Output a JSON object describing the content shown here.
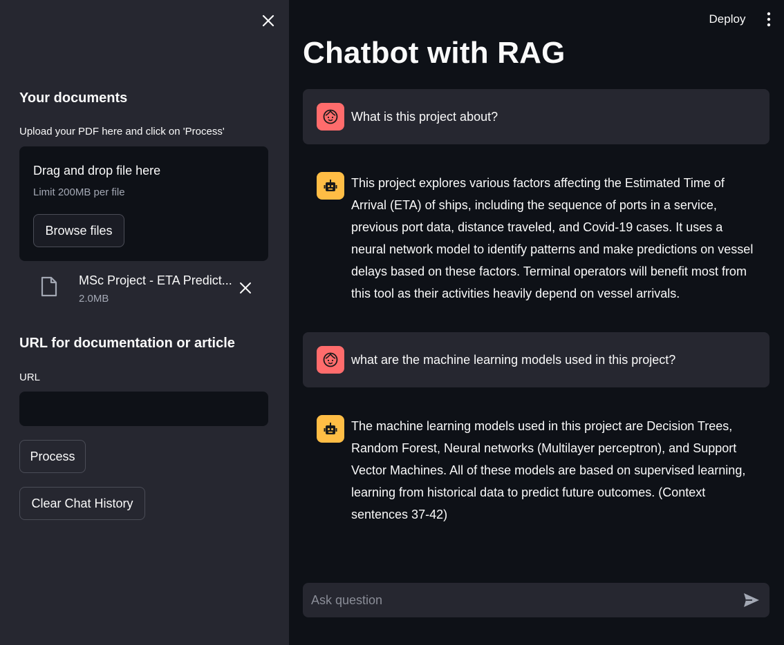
{
  "sidebar": {
    "documents_heading": "Your documents",
    "upload_label": "Upload your PDF here and click on 'Process'",
    "uploader": {
      "title": "Drag and drop file here",
      "limit": "Limit 200MB per file",
      "browse_label": "Browse files"
    },
    "file": {
      "name": "MSc Project - ETA Predict...",
      "size": "2.0MB"
    },
    "url_heading": "URL for documentation or article",
    "url_label": "URL",
    "url_value": "",
    "process_label": "Process",
    "clear_label": "Clear Chat History"
  },
  "header": {
    "deploy_label": "Deploy"
  },
  "main": {
    "title": "Chatbot with RAG",
    "messages": [
      {
        "role": "user",
        "text": "What is this project about?"
      },
      {
        "role": "assistant",
        "text": "This project explores various factors affecting the Estimated Time of Arrival (ETA) of ships, including the sequence of ports in a service, previous port data, distance traveled, and Covid-19 cases. It uses a neural network model to identify patterns and make predictions on vessel delays based on these factors. Terminal operators will benefit most from this tool as their activities heavily depend on vessel arrivals."
      },
      {
        "role": "user",
        "text": "what are the machine learning models used in this project?"
      },
      {
        "role": "assistant",
        "text": "The machine learning models used in this project are Decision Trees, Random Forest, Neural networks (Multilayer perceptron), and Support Vector Machines. All of these models are based on supervised learning, learning from historical data to predict future outcomes. (Context sentences 37-42)"
      }
    ],
    "chat_placeholder": "Ask question"
  },
  "colors": {
    "user_avatar": "#ff6c6c",
    "bot_avatar": "#ffbd45",
    "sidebar_bg": "#262730",
    "main_bg": "#0e1117"
  },
  "icons": {
    "sidebar_close": "close-icon",
    "file": "file-icon",
    "file_remove": "close-icon",
    "menu": "kebab-menu-icon",
    "user": "user-face-icon",
    "assistant": "robot-icon",
    "send": "send-icon"
  }
}
